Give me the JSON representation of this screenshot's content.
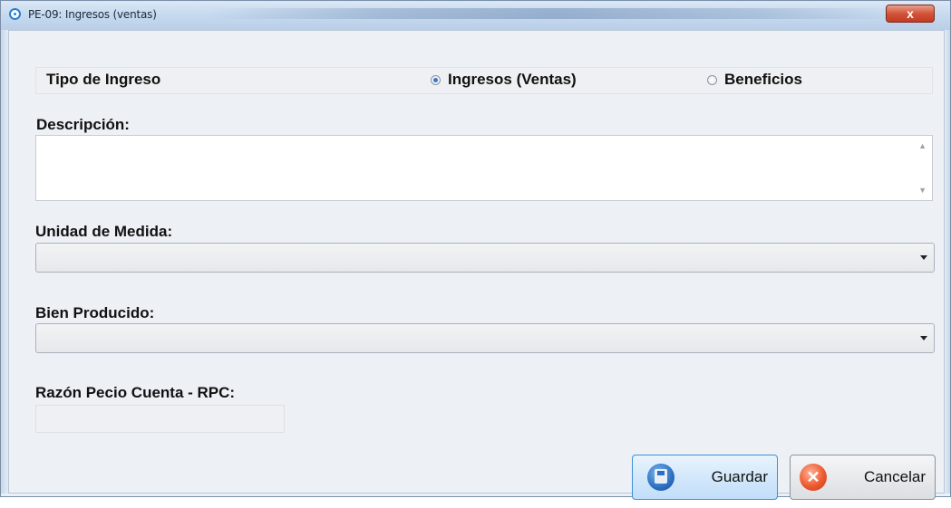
{
  "window": {
    "title": "PE-09: Ingresos (ventas)",
    "close_glyph": "x"
  },
  "form": {
    "tipo_label": "Tipo de Ingreso",
    "radio_options": [
      {
        "label": "Ingresos (Ventas)",
        "checked": true
      },
      {
        "label": "Beneficios",
        "checked": false
      }
    ],
    "descripcion_label": "Descripción:",
    "descripcion_value": "",
    "unidad_label": "Unidad de Medida:",
    "unidad_value": "",
    "bien_label": "Bien Producido:",
    "bien_value": "",
    "rpc_label": "Razón Pecio Cuenta - RPC:",
    "rpc_value": ""
  },
  "buttons": {
    "guardar": "Guardar",
    "cancelar": "Cancelar"
  },
  "icons": {
    "app": "radio-circle-icon",
    "save": "floppy-disk-icon",
    "cancel": "close-circle-icon"
  },
  "colors": {
    "accent": "#3c8fd8",
    "close": "#d2543a"
  }
}
